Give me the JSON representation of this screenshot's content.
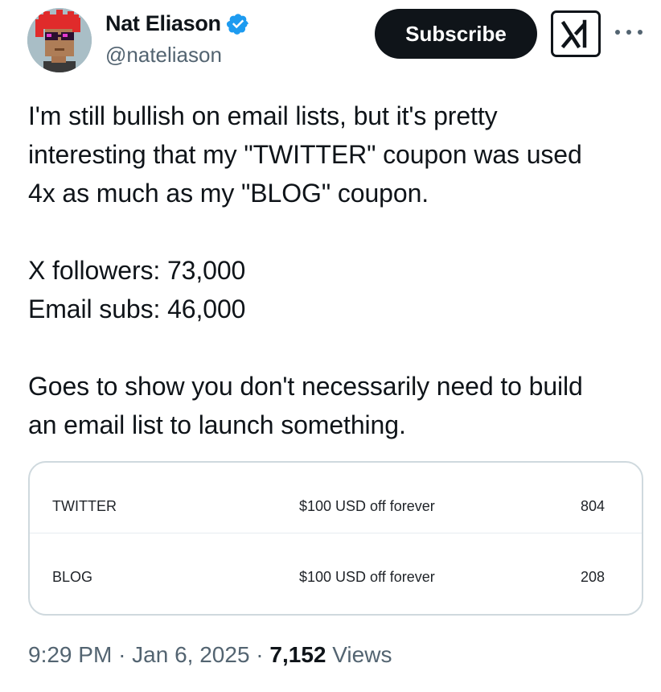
{
  "author": {
    "display_name": "Nat Eliason",
    "handle": "@nateliason",
    "verified": true
  },
  "actions": {
    "subscribe_label": "Subscribe",
    "grok_icon": "grok-icon",
    "more_icon": "more-icon"
  },
  "tweet": {
    "lines": [
      "I'm still bullish on email lists, but it's pretty",
      "interesting that my \"TWITTER\" coupon was used",
      "4x as much as my \"BLOG\" coupon.",
      "",
      "X followers: 73,000",
      "Email subs: 46,000",
      "",
      "Goes to show you don't necessarily need to build",
      "an email list to launch something."
    ]
  },
  "coupon_table": {
    "rows": [
      {
        "code": "TWITTER",
        "description": "$100 USD off forever",
        "redemptions": "804"
      },
      {
        "code": "BLOG",
        "description": "$100 USD off forever",
        "redemptions": "208"
      }
    ]
  },
  "meta": {
    "time": "9:29 PM",
    "date": "Jan 6, 2025",
    "separator": "·",
    "views_count": "7,152",
    "views_label": "Views"
  },
  "colors": {
    "verified_badge": "#1d9bf0",
    "text_primary": "#0f1419",
    "text_secondary": "#536471",
    "border": "#cfd9de"
  }
}
